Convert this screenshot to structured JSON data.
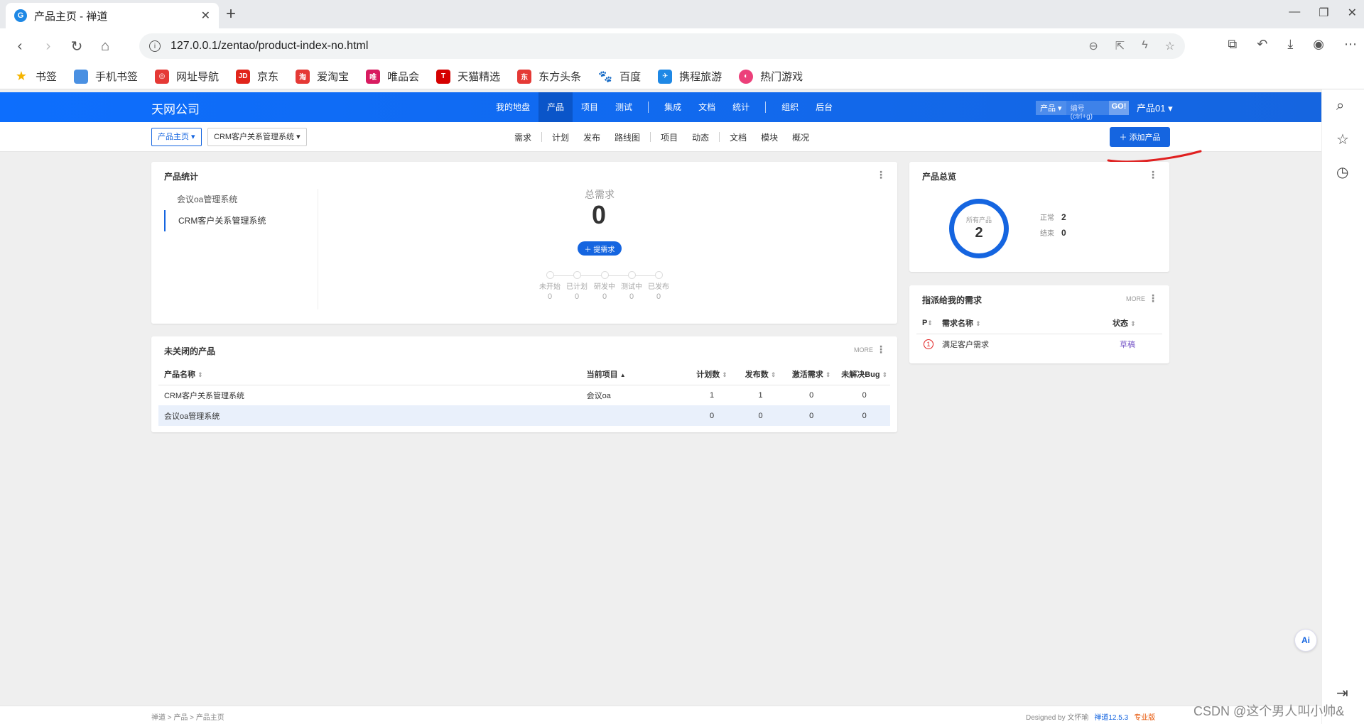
{
  "browser": {
    "tab_title": "产品主页 - 禅道",
    "url": "127.0.0.1/zentao/product-index-no.html",
    "bookmarks": [
      "书签",
      "手机书签",
      "网址导航",
      "京东",
      "爱淘宝",
      "唯品会",
      "天猫精选",
      "东方头条",
      "百度",
      "携程旅游",
      "热门游戏"
    ]
  },
  "app": {
    "company": "天网公司",
    "main_menu": [
      "我的地盘",
      "产品",
      "项目",
      "测试",
      "集成",
      "文档",
      "统计",
      "组织",
      "后台"
    ],
    "active_menu": "产品",
    "search": {
      "type": "产品",
      "placeholder": "编号(ctrl+g)",
      "go": "GO!"
    },
    "user": "产品01",
    "breadcrumb": [
      "产品主页",
      "CRM客户关系管理系统"
    ],
    "sub_menu": [
      "需求",
      "计划",
      "发布",
      "路线图",
      "项目",
      "动态",
      "文档",
      "模块",
      "概况"
    ],
    "add_product_label": "添加产品"
  },
  "product_stats": {
    "title": "产品统计",
    "products": [
      "会议oa管理系统",
      "CRM客户关系管理系统"
    ],
    "active_index": 1,
    "total_label": "总需求",
    "total_value": "0",
    "raise_label": "提需求",
    "stages": [
      {
        "label": "未开始",
        "value": "0"
      },
      {
        "label": "已计划",
        "value": "0"
      },
      {
        "label": "研发中",
        "value": "0"
      },
      {
        "label": "测试中",
        "value": "0"
      },
      {
        "label": "已发布",
        "value": "0"
      }
    ]
  },
  "overview": {
    "title": "产品总览",
    "ring_label": "所有产品",
    "ring_value": "2",
    "normal_label": "正常",
    "normal_value": "2",
    "closed_label": "结束",
    "closed_value": "0"
  },
  "assigned": {
    "title": "指派给我的需求",
    "more": "MORE",
    "columns": [
      "P",
      "需求名称",
      "状态"
    ],
    "rows": [
      {
        "priority": "1",
        "name": "满足客户需求",
        "status": "草稿"
      }
    ]
  },
  "unclosed": {
    "title": "未关闭的产品",
    "more": "MORE",
    "columns": [
      "产品名称",
      "当前项目",
      "计划数",
      "发布数",
      "激活需求",
      "未解决Bug"
    ],
    "rows": [
      {
        "name": "CRM客户关系管理系统",
        "project": "会议oa",
        "plans": "1",
        "releases": "1",
        "active": "0",
        "bugs": "0"
      },
      {
        "name": "会议oa管理系统",
        "project": "",
        "plans": "0",
        "releases": "0",
        "active": "0",
        "bugs": "0"
      }
    ]
  },
  "footer": {
    "breadcrumb": "禅道 > 产品 > 产品主页",
    "designed_by": "Designed by 文怀瑜",
    "version": "禅道12.5.3",
    "edition": "专业版"
  },
  "watermark": "CSDN @这个男人叫小帅&",
  "colors": {
    "primary": "#1565e0",
    "annotation": "#e02020"
  }
}
